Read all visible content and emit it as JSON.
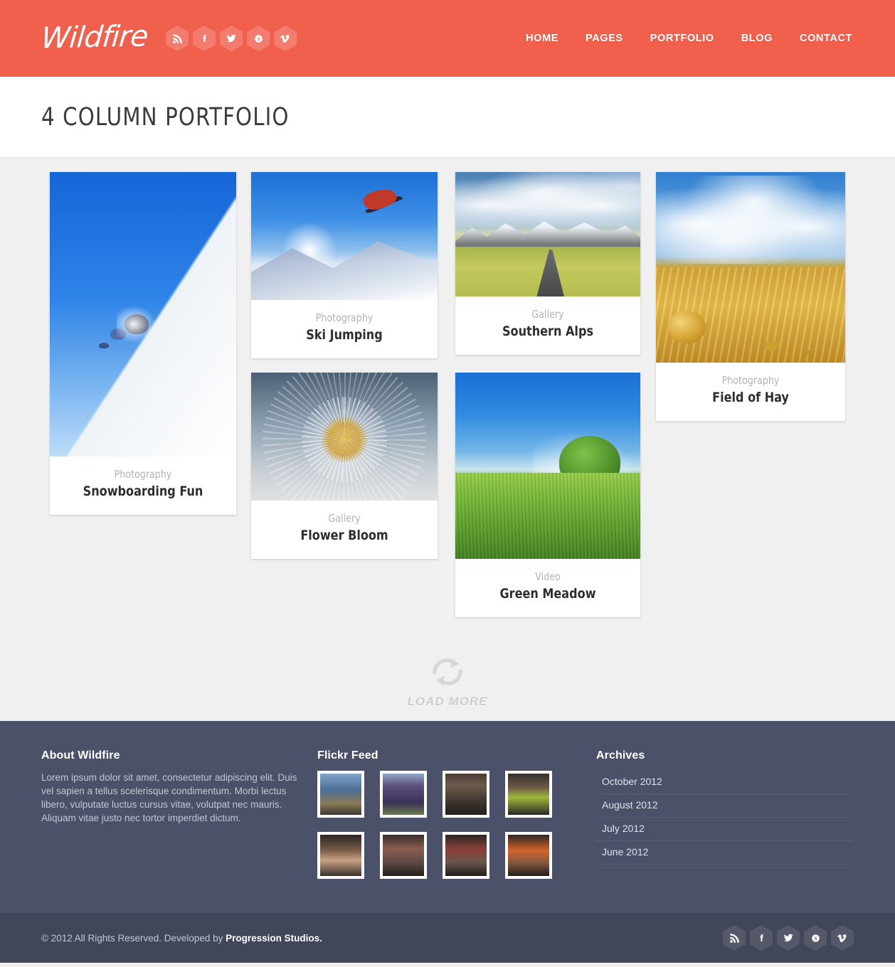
{
  "header": {
    "logo": "Wildfire",
    "brand_color": "#f0604d",
    "social": [
      {
        "name": "rss-icon",
        "label": "RSS"
      },
      {
        "name": "facebook-icon",
        "label": "Facebook"
      },
      {
        "name": "twitter-icon",
        "label": "Twitter"
      },
      {
        "name": "skype-icon",
        "label": "Skype"
      },
      {
        "name": "vimeo-icon",
        "label": "Vimeo"
      }
    ],
    "nav": [
      {
        "label": "HOME"
      },
      {
        "label": "PAGES"
      },
      {
        "label": "PORTFOLIO"
      },
      {
        "label": "BLOG"
      },
      {
        "label": "CONTACT"
      }
    ]
  },
  "page": {
    "title": "4 COLUMN PORTFOLIO"
  },
  "portfolio": {
    "items": [
      {
        "category": "Photography",
        "title": "Snowboarding Fun"
      },
      {
        "category": "Photography",
        "title": "Ski Jumping"
      },
      {
        "category": "Gallery",
        "title": "Southern Alps"
      },
      {
        "category": "Photography",
        "title": "Field of Hay"
      },
      {
        "category": "Gallery",
        "title": "Flower Bloom"
      },
      {
        "category": "Video",
        "title": "Green Meadow"
      }
    ],
    "load_more": "LOAD MORE"
  },
  "footer": {
    "about": {
      "title": "About Wildfire",
      "text": "Lorem ipsum dolor sit amet, consectetur adipiscing elit. Duis vel sapien a tellus scelerisque condimentum. Morbi lectus libero, vulputate luctus cursus vitae, volutpat nec mauris. Aliquam vitae justo nec tortor imperdiet dictum."
    },
    "flickr": {
      "title": "Flickr Feed",
      "count": 8
    },
    "archives": {
      "title": "Archives",
      "items": [
        {
          "label": "October 2012"
        },
        {
          "label": "August 2012"
        },
        {
          "label": "July 2012"
        },
        {
          "label": "June 2012"
        }
      ]
    },
    "background_color": "#4b5168"
  },
  "copyright": {
    "prefix": "© 2012 All Rights Reserved. Developed by ",
    "brand": "Progression Studios.",
    "social": [
      {
        "name": "rss-icon",
        "label": "RSS"
      },
      {
        "name": "facebook-icon",
        "label": "Facebook"
      },
      {
        "name": "twitter-icon",
        "label": "Twitter"
      },
      {
        "name": "skype-icon",
        "label": "Skype"
      },
      {
        "name": "vimeo-icon",
        "label": "Vimeo"
      }
    ]
  }
}
